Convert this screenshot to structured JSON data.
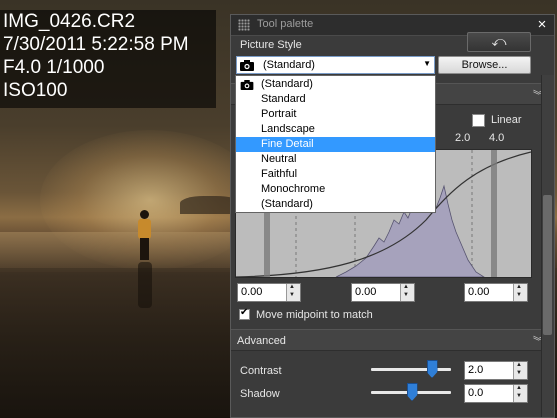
{
  "info": {
    "filename": "IMG_0426.CR2",
    "datetime": "7/30/2011 5:22:58 PM",
    "exposure": "F4.0 1/1000",
    "iso": "ISO100"
  },
  "palette": {
    "title": "Tool palette",
    "close_glyph": "×",
    "picture_style_label": "Picture Style",
    "undo_glyph": "⤺",
    "selected_style": "(Standard)",
    "browse_label": "Browse...",
    "style_options": [
      "(Standard)",
      "Standard",
      "Portrait",
      "Landscape",
      "Fine Detail",
      "Neutral",
      "Faithful",
      "Monochrome",
      "(Standard)"
    ],
    "highlighted_option": "Fine Detail",
    "linear_label": "Linear",
    "linear_checked": false,
    "curve_ticks": [
      "2.0",
      "4.0"
    ],
    "level_values": [
      "0.00",
      "0.00",
      "0.00"
    ],
    "move_midpoint_label": "Move midpoint to match",
    "move_midpoint_checked": true,
    "advanced_label": "Advanced",
    "contrast_label": "Contrast",
    "contrast_value": "2.0",
    "contrast_level": 0.75,
    "shadow_label": "Shadow",
    "shadow_value": "0.0",
    "shadow_level": 0.5
  },
  "icons": {
    "camera": "camera-icon",
    "chevron": "double-chevron-down-icon",
    "spin": "spin-arrows-icon"
  }
}
